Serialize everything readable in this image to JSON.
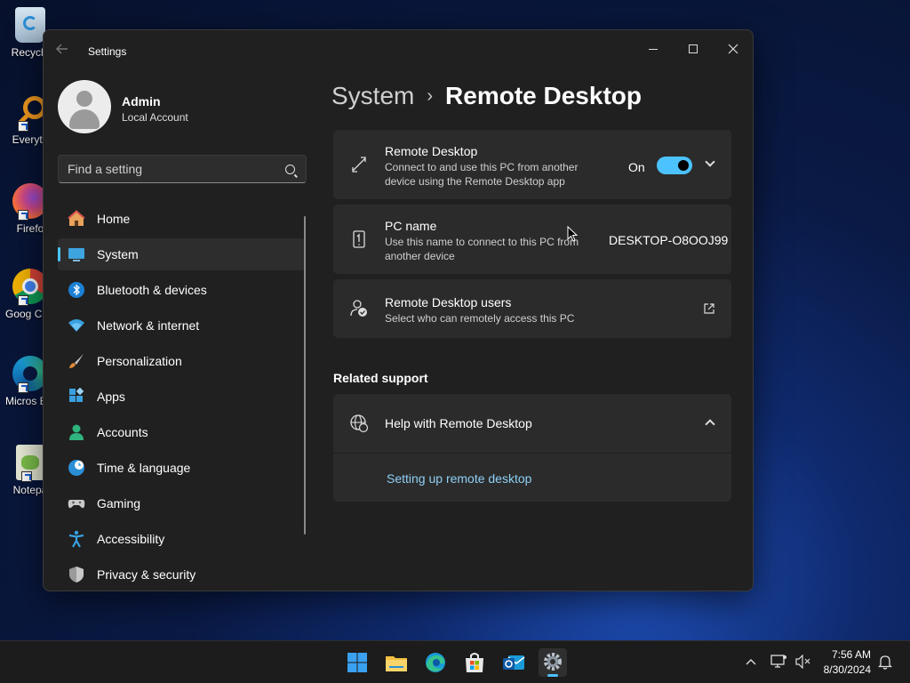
{
  "desktop": {
    "icons": [
      {
        "label": "Recycle"
      },
      {
        "label": "Everyth"
      },
      {
        "label": "Firefo"
      },
      {
        "label": "Goog Chron"
      },
      {
        "label": "Micros Edge"
      },
      {
        "label": "Notepa"
      }
    ]
  },
  "window": {
    "title": "Settings"
  },
  "user": {
    "name": "Admin",
    "account_type": "Local Account"
  },
  "search": {
    "placeholder": "Find a setting"
  },
  "nav": {
    "items": [
      {
        "label": "Home",
        "icon": "home-icon"
      },
      {
        "label": "System",
        "icon": "system-icon"
      },
      {
        "label": "Bluetooth & devices",
        "icon": "bluetooth-icon"
      },
      {
        "label": "Network & internet",
        "icon": "wifi-icon"
      },
      {
        "label": "Personalization",
        "icon": "brush-icon"
      },
      {
        "label": "Apps",
        "icon": "apps-icon"
      },
      {
        "label": "Accounts",
        "icon": "person-icon"
      },
      {
        "label": "Time & language",
        "icon": "clock-globe-icon"
      },
      {
        "label": "Gaming",
        "icon": "gamepad-icon"
      },
      {
        "label": "Accessibility",
        "icon": "accessibility-icon"
      },
      {
        "label": "Privacy & security",
        "icon": "shield-icon"
      }
    ],
    "active": "System"
  },
  "breadcrumb": {
    "parent": "System",
    "separator": "›",
    "current": "Remote Desktop"
  },
  "remote_desktop": {
    "title": "Remote Desktop",
    "description": "Connect to and use this PC from another device using the Remote Desktop app",
    "toggle_label": "On",
    "toggle_state": true
  },
  "pc_name": {
    "title": "PC name",
    "description": "Use this name to connect to this PC from another device",
    "value": "DESKTOP-O8OOJ99"
  },
  "rd_users": {
    "title": "Remote Desktop users",
    "description": "Select who can remotely access this PC"
  },
  "related_support": {
    "title": "Related support",
    "help_title": "Help with Remote Desktop",
    "link": "Setting up remote desktop"
  },
  "taskbar": {
    "time": "7:56 AM",
    "date": "8/30/2024"
  },
  "colors": {
    "accent": "#4cc2ff",
    "window_bg": "#202020",
    "card_bg": "#2b2b2b",
    "link": "#8fd0f5"
  }
}
